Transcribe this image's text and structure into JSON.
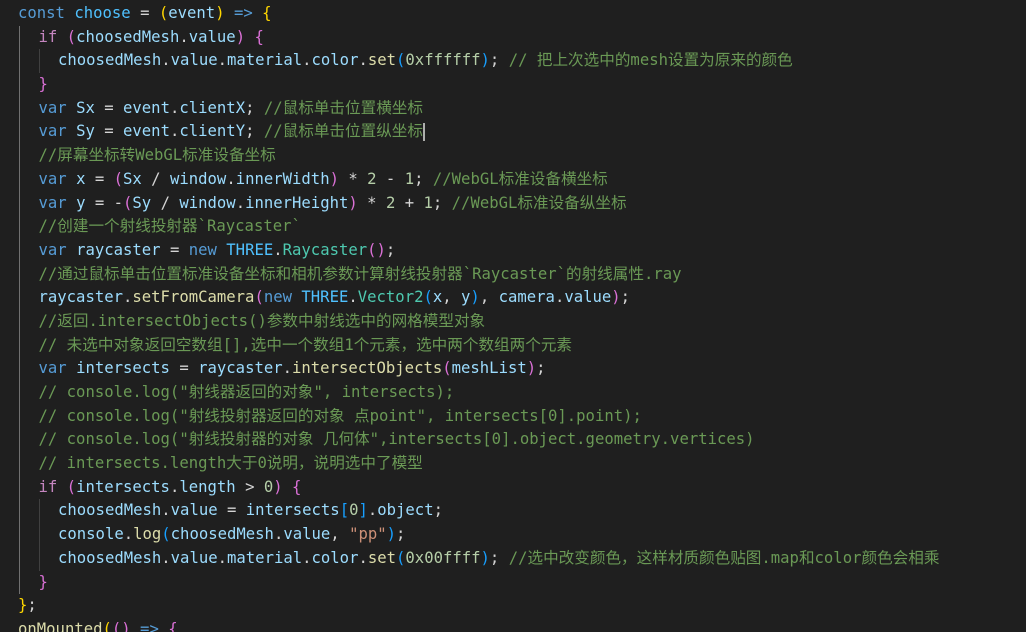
{
  "editor": {
    "theme_colors": {
      "background": "#1f1f1f",
      "keyword": "#569cd6",
      "control": "#c586c0",
      "variable": "#9cdcfe",
      "constant": "#4fc1ff",
      "function": "#dcdcaa",
      "class": "#4ec9b0",
      "number": "#b5cea8",
      "string": "#ce9178",
      "comment": "#6a9955",
      "bracket1": "#ffd700",
      "bracket2": "#da70d6",
      "bracket3": "#179fff",
      "guide_active": "#707070",
      "guide": "#404040"
    },
    "lines": [
      [
        [
          "kw",
          "const "
        ],
        [
          "const",
          "choose"
        ],
        [
          "op",
          " = "
        ],
        [
          "p1",
          "("
        ],
        [
          "var",
          "event"
        ],
        [
          "p1",
          ")"
        ],
        [
          "kw",
          " => "
        ],
        [
          "p1",
          "{"
        ]
      ],
      [
        [
          "ctrl",
          "if "
        ],
        [
          "p2",
          "("
        ],
        [
          "var",
          "choosedMesh"
        ],
        [
          "op",
          "."
        ],
        [
          "var",
          "value"
        ],
        [
          "p2",
          ")"
        ],
        [
          "op",
          " "
        ],
        [
          "p2",
          "{"
        ]
      ],
      [
        [
          "var",
          "choosedMesh"
        ],
        [
          "op",
          "."
        ],
        [
          "var",
          "value"
        ],
        [
          "op",
          "."
        ],
        [
          "var",
          "material"
        ],
        [
          "op",
          "."
        ],
        [
          "var",
          "color"
        ],
        [
          "op",
          "."
        ],
        [
          "fn",
          "set"
        ],
        [
          "p3",
          "("
        ],
        [
          "num",
          "0xffffff"
        ],
        [
          "p3",
          ")"
        ],
        [
          "op",
          "; "
        ],
        [
          "cmt",
          "// 把上次选中的mesh设置为原来的颜色"
        ]
      ],
      [
        [
          "p2",
          "}"
        ]
      ],
      [
        [
          "kw",
          "var "
        ],
        [
          "var",
          "Sx"
        ],
        [
          "op",
          " = "
        ],
        [
          "var",
          "event"
        ],
        [
          "op",
          "."
        ],
        [
          "var",
          "clientX"
        ],
        [
          "op",
          "; "
        ],
        [
          "cmt",
          "//鼠标单击位置横坐标"
        ]
      ],
      [
        [
          "kw",
          "var "
        ],
        [
          "var",
          "Sy"
        ],
        [
          "op",
          " = "
        ],
        [
          "var",
          "event"
        ],
        [
          "op",
          "."
        ],
        [
          "var",
          "clientY"
        ],
        [
          "op",
          "; "
        ],
        [
          "cmt",
          "//鼠标单击位置纵坐标"
        ],
        [
          "cursor",
          ""
        ]
      ],
      [
        [
          "cmt",
          "//屏幕坐标转WebGL标准设备坐标"
        ]
      ],
      [
        [
          "kw",
          "var "
        ],
        [
          "var",
          "x"
        ],
        [
          "op",
          " = "
        ],
        [
          "p2",
          "("
        ],
        [
          "var",
          "Sx"
        ],
        [
          "op",
          " / "
        ],
        [
          "var",
          "window"
        ],
        [
          "op",
          "."
        ],
        [
          "var",
          "innerWidth"
        ],
        [
          "p2",
          ")"
        ],
        [
          "op",
          " * "
        ],
        [
          "num",
          "2"
        ],
        [
          "op",
          " - "
        ],
        [
          "num",
          "1"
        ],
        [
          "op",
          "; "
        ],
        [
          "cmt",
          "//WebGL标准设备横坐标"
        ]
      ],
      [
        [
          "kw",
          "var "
        ],
        [
          "var",
          "y"
        ],
        [
          "op",
          " = -"
        ],
        [
          "p2",
          "("
        ],
        [
          "var",
          "Sy"
        ],
        [
          "op",
          " / "
        ],
        [
          "var",
          "window"
        ],
        [
          "op",
          "."
        ],
        [
          "var",
          "innerHeight"
        ],
        [
          "p2",
          ")"
        ],
        [
          "op",
          " * "
        ],
        [
          "num",
          "2"
        ],
        [
          "op",
          " + "
        ],
        [
          "num",
          "1"
        ],
        [
          "op",
          "; "
        ],
        [
          "cmt",
          "//WebGL标准设备纵坐标"
        ]
      ],
      [
        [
          "cmt",
          "//创建一个射线投射器`Raycaster`"
        ]
      ],
      [
        [
          "kw",
          "var "
        ],
        [
          "var",
          "raycaster"
        ],
        [
          "op",
          " = "
        ],
        [
          "kw",
          "new "
        ],
        [
          "const",
          "THREE"
        ],
        [
          "op",
          "."
        ],
        [
          "cls",
          "Raycaster"
        ],
        [
          "p2",
          "()"
        ],
        [
          "op",
          ";"
        ]
      ],
      [
        [
          "cmt",
          "//通过鼠标单击位置标准设备坐标和相机参数计算射线投射器`Raycaster`的射线属性.ray"
        ]
      ],
      [
        [
          "var",
          "raycaster"
        ],
        [
          "op",
          "."
        ],
        [
          "fn",
          "setFromCamera"
        ],
        [
          "p2",
          "("
        ],
        [
          "kw",
          "new "
        ],
        [
          "const",
          "THREE"
        ],
        [
          "op",
          "."
        ],
        [
          "cls",
          "Vector2"
        ],
        [
          "p3",
          "("
        ],
        [
          "var",
          "x"
        ],
        [
          "op",
          ", "
        ],
        [
          "var",
          "y"
        ],
        [
          "p3",
          ")"
        ],
        [
          "op",
          ", "
        ],
        [
          "var",
          "camera"
        ],
        [
          "op",
          "."
        ],
        [
          "var",
          "value"
        ],
        [
          "p2",
          ")"
        ],
        [
          "op",
          ";"
        ]
      ],
      [
        [
          "cmt",
          "//返回.intersectObjects()参数中射线选中的网格模型对象"
        ]
      ],
      [
        [
          "cmt",
          "// 未选中对象返回空数组[],选中一个数组1个元素，选中两个数组两个元素"
        ]
      ],
      [
        [
          "kw",
          "var "
        ],
        [
          "var",
          "intersects"
        ],
        [
          "op",
          " = "
        ],
        [
          "var",
          "raycaster"
        ],
        [
          "op",
          "."
        ],
        [
          "fn",
          "intersectObjects"
        ],
        [
          "p2",
          "("
        ],
        [
          "var",
          "meshList"
        ],
        [
          "p2",
          ")"
        ],
        [
          "op",
          ";"
        ]
      ],
      [
        [
          "cmt",
          "// console.log(\"射线器返回的对象\", intersects);"
        ]
      ],
      [
        [
          "cmt",
          "// console.log(\"射线投射器返回的对象 点point\", intersects[0].point);"
        ]
      ],
      [
        [
          "cmt",
          "// console.log(\"射线投射器的对象 几何体\",intersects[0].object.geometry.vertices)"
        ]
      ],
      [
        [
          "cmt",
          "// intersects.length大于0说明，说明选中了模型"
        ]
      ],
      [
        [
          "ctrl",
          "if "
        ],
        [
          "p2",
          "("
        ],
        [
          "var",
          "intersects"
        ],
        [
          "op",
          "."
        ],
        [
          "var",
          "length"
        ],
        [
          "op",
          " > "
        ],
        [
          "num",
          "0"
        ],
        [
          "p2",
          ")"
        ],
        [
          "op",
          " "
        ],
        [
          "p2",
          "{"
        ]
      ],
      [
        [
          "var",
          "choosedMesh"
        ],
        [
          "op",
          "."
        ],
        [
          "var",
          "value"
        ],
        [
          "op",
          " = "
        ],
        [
          "var",
          "intersects"
        ],
        [
          "p3",
          "["
        ],
        [
          "num",
          "0"
        ],
        [
          "p3",
          "]"
        ],
        [
          "op",
          "."
        ],
        [
          "var",
          "object"
        ],
        [
          "op",
          ";"
        ]
      ],
      [
        [
          "var",
          "console"
        ],
        [
          "op",
          "."
        ],
        [
          "fn",
          "log"
        ],
        [
          "p3",
          "("
        ],
        [
          "var",
          "choosedMesh"
        ],
        [
          "op",
          "."
        ],
        [
          "var",
          "value"
        ],
        [
          "op",
          ", "
        ],
        [
          "str",
          "\"pp\""
        ],
        [
          "p3",
          ")"
        ],
        [
          "op",
          ";"
        ]
      ],
      [
        [
          "var",
          "choosedMesh"
        ],
        [
          "op",
          "."
        ],
        [
          "var",
          "value"
        ],
        [
          "op",
          "."
        ],
        [
          "var",
          "material"
        ],
        [
          "op",
          "."
        ],
        [
          "var",
          "color"
        ],
        [
          "op",
          "."
        ],
        [
          "fn",
          "set"
        ],
        [
          "p3",
          "("
        ],
        [
          "num",
          "0x00ffff"
        ],
        [
          "p3",
          ")"
        ],
        [
          "op",
          "; "
        ],
        [
          "cmt",
          "//选中改变颜色，这样材质颜色贴图.map和color颜色会相乘"
        ]
      ],
      [
        [
          "p2",
          "}"
        ]
      ],
      [
        [
          "p1",
          "}"
        ],
        [
          "op",
          ";"
        ]
      ],
      [
        [
          "fn",
          "onMounted"
        ],
        [
          "p1",
          "("
        ],
        [
          "p2",
          "()"
        ],
        [
          "kw",
          " => "
        ],
        [
          "p2",
          "{"
        ]
      ]
    ],
    "indents": [
      0,
      1,
      2,
      1,
      1,
      1,
      1,
      1,
      1,
      1,
      1,
      1,
      1,
      1,
      1,
      1,
      1,
      1,
      1,
      1,
      1,
      2,
      2,
      2,
      1,
      0,
      0
    ]
  }
}
